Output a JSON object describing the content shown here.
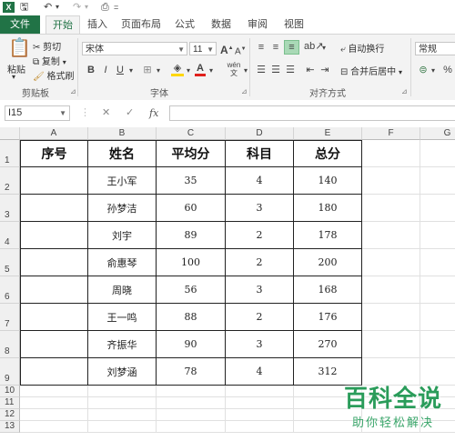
{
  "qat": {
    "app_icon": "X",
    "dropdown": "="
  },
  "tabs": [
    "文件",
    "开始",
    "插入",
    "页面布局",
    "公式",
    "数据",
    "审阅",
    "视图"
  ],
  "ribbon": {
    "clipboard": {
      "paste": "粘贴",
      "cut": "剪切",
      "copy": "复制",
      "format_painter": "格式刷",
      "label": "剪贴板"
    },
    "font": {
      "name": "宋体",
      "size": "11",
      "bold": "B",
      "italic": "I",
      "underline": "U",
      "font_color_letter": "A",
      "wen": "wén",
      "label": "字体"
    },
    "alignment": {
      "wrap_text": "自动换行",
      "merge_center": "合并后居中",
      "label": "对齐方式"
    },
    "number": {
      "format": "常规",
      "percent": "%"
    }
  },
  "formula_bar": {
    "name_box": "I15",
    "cancel": "✕",
    "enter": "✓",
    "fx": "fx",
    "value": ""
  },
  "columns": [
    "A",
    "B",
    "C",
    "D",
    "E",
    "F",
    "G"
  ],
  "rows": [
    "1",
    "2",
    "3",
    "4",
    "5",
    "6",
    "7",
    "8",
    "9",
    "10",
    "11",
    "12",
    "13"
  ],
  "table": {
    "headers": [
      "序号",
      "姓名",
      "平均分",
      "科目",
      "总分"
    ],
    "data": [
      [
        "",
        "王小军",
        "35",
        "4",
        "140"
      ],
      [
        "",
        "孙梦洁",
        "60",
        "3",
        "180"
      ],
      [
        "",
        "刘宇",
        "89",
        "2",
        "178"
      ],
      [
        "",
        "俞惠琴",
        "100",
        "2",
        "200"
      ],
      [
        "",
        "周晓",
        "56",
        "3",
        "168"
      ],
      [
        "",
        "王一鸣",
        "88",
        "2",
        "176"
      ],
      [
        "",
        "齐振华",
        "90",
        "3",
        "270"
      ],
      [
        "",
        "刘梦涵",
        "78",
        "4",
        "312"
      ]
    ]
  },
  "watermark": {
    "title": "百科全说",
    "subtitle": "助你轻松解决"
  },
  "colors": {
    "excel_green": "#217346",
    "watermark_green": "#2a9c5a"
  }
}
